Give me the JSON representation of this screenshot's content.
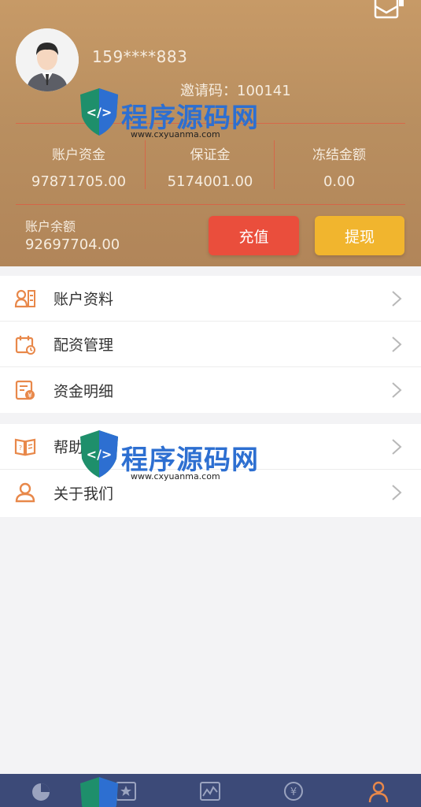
{
  "account": {
    "phone": "159****883",
    "invite_code": "邀请码：100141"
  },
  "stats": [
    {
      "label": "账户资金",
      "value": "97871705.00"
    },
    {
      "label": "保证金",
      "value": "5174001.00"
    },
    {
      "label": "冻结金额",
      "value": "0.00"
    }
  ],
  "balance": {
    "label": "账户余额",
    "value": "92697704.00"
  },
  "buttons": {
    "recharge": "充值",
    "withdraw": "提现"
  },
  "menu_group_1": [
    {
      "label": "账户资料",
      "icon": "user-card-icon"
    },
    {
      "label": "配资管理",
      "icon": "calendar-icon"
    },
    {
      "label": "资金明细",
      "icon": "ledger-icon"
    }
  ],
  "menu_group_2": [
    {
      "label": "帮助中心",
      "icon": "book-icon"
    },
    {
      "label": "关于我们",
      "icon": "person-icon"
    }
  ],
  "tabbar": [
    {
      "icon": "pie-chart-icon"
    },
    {
      "icon": "star-icon"
    },
    {
      "icon": "trend-icon"
    },
    {
      "icon": "yen-icon"
    },
    {
      "icon": "user-icon"
    }
  ],
  "watermark": {
    "brand": "程序源码网",
    "url": "www.cxyuanma.com"
  },
  "colors": {
    "header": "#b98f60",
    "accent": "#e5533e",
    "recharge": "#ea4e3c",
    "withdraw": "#f1b52e",
    "tabbar": "#3c4a78"
  }
}
